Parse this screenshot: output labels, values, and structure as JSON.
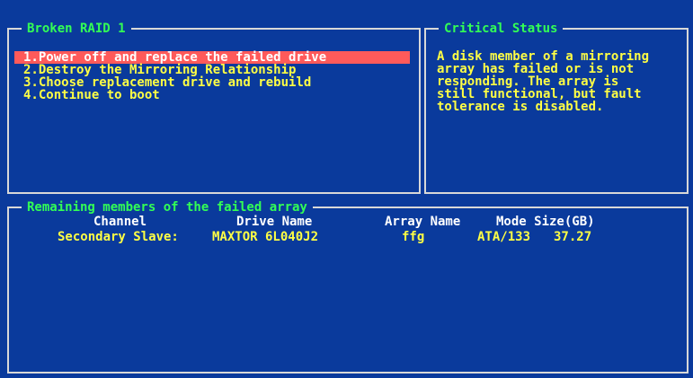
{
  "panels": {
    "left_title": "Broken RAID 1",
    "right_title": "Critical Status",
    "bottom_title": "Remaining members of the failed array"
  },
  "menu": {
    "items": [
      {
        "label": "1.Power off and replace the failed drive"
      },
      {
        "label": "2.Destroy the Mirroring Relationship"
      },
      {
        "label": "3.Choose replacement drive and rebuild"
      },
      {
        "label": "4.Continue to boot"
      }
    ]
  },
  "status": {
    "message": "A disk member of a mirroring\narray has failed or is not\nresponding. The array is\nstill functional, but fault\ntolerance is disabled."
  },
  "table": {
    "headers": {
      "channel": "Channel",
      "drive_name": "Drive Name",
      "array_name": "Array Name",
      "mode_size": "Mode Size(GB)"
    },
    "rows": [
      {
        "channel": "Secondary Slave:",
        "drive_name": "MAXTOR 6L040J2",
        "array_name": "ffg",
        "mode": "ATA/133",
        "size": "37.27"
      }
    ]
  },
  "colors": {
    "background": "#0a3a9c",
    "title": "#33ff55",
    "text": "#ffff44",
    "highlight": "#ff5a5a",
    "border": "#d8d8d8"
  }
}
